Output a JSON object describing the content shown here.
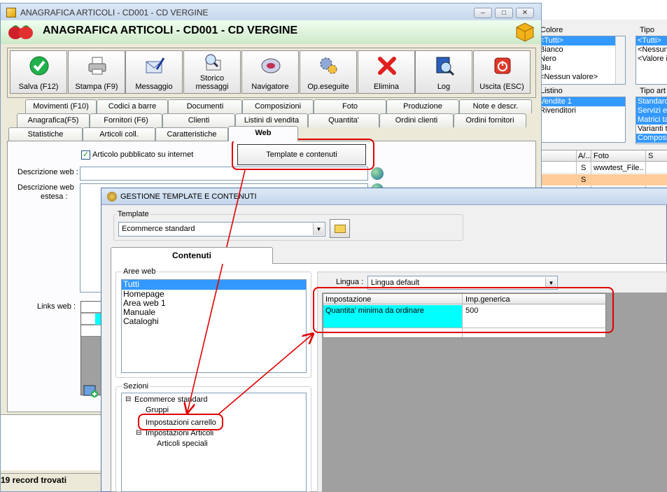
{
  "right_panel": {
    "colore_label": "Colore",
    "tipo_label": "Tipo",
    "colore_items": [
      "<Tutti>",
      "Bianco",
      "Nero",
      "Blu",
      "<Nessun valore>"
    ],
    "tipo_items": [
      "<Tutti>",
      "<Nessun",
      "<Valore i"
    ],
    "listino_label": "Listino",
    "tipo_articolo_label": "Tipo art",
    "listino_items": [
      "Vendite 1",
      "Rivenditori"
    ],
    "tipo_articolo_items": [
      "Standard",
      "Servizi e",
      "Matrici ta",
      "Varianti t",
      "Composi"
    ],
    "grid_headers": [
      "",
      "A/...",
      "Foto",
      "S"
    ],
    "grid_rows": [
      {
        "c1": "S",
        "c2": "wwwtest_File..."
      },
      {
        "c1": "S",
        "c2": ""
      }
    ]
  },
  "main_window": {
    "title": "ANAGRAFICA ARTICOLI - CD001 - CD VERGINE",
    "header": "ANAGRAFICA ARTICOLI - CD001 - CD VERGINE",
    "toolbar": [
      {
        "icon": "check-icon",
        "label": "Salva (F12)"
      },
      {
        "icon": "printer-icon",
        "label": "Stampa (F9)"
      },
      {
        "icon": "envelope-pen-icon",
        "label": "Messaggio"
      },
      {
        "icon": "magnifier-envelope-icon",
        "label": "Storico messaggi"
      },
      {
        "icon": "navigator-icon",
        "label": "Navigatore"
      },
      {
        "icon": "gears-icon",
        "label": "Op.eseguite"
      },
      {
        "icon": "red-x-icon",
        "label": "Elimina"
      },
      {
        "icon": "log-book-icon",
        "label": "Log"
      },
      {
        "icon": "power-icon",
        "label": "Uscita (ESC)"
      }
    ],
    "tabs_row1": [
      "Movimenti (F10)",
      "Codici a barre",
      "Documenti",
      "Composizioni",
      "Foto",
      "Produzione",
      "Note e descr."
    ],
    "tabs_row2": [
      "Anagrafica(F5)",
      "Fornitori (F6)",
      "Clienti",
      "Listini di vendita",
      "Quantita'",
      "Ordini clienti",
      "Ordini fornitori"
    ],
    "tabs_row3": [
      "Statistiche",
      "Articoli coll.",
      "Caratteristiche",
      "Web"
    ],
    "checkbox_label": "Articolo pubblicato su internet",
    "template_button": "Template e contenuti",
    "descrizione_web_label": "Descrizione web :",
    "descrizione_estesa_label1": "Descrizione web",
    "descrizione_estesa_label2": "estesa :",
    "links_label": "Links web :",
    "status": "19 record trovati"
  },
  "dialog": {
    "title": "GESTIONE TEMPLATE E CONTENUTI",
    "template_group": "Template",
    "template_value": "Ecommerce standard",
    "tab_label": "Contenuti",
    "aree_label": "Aree web",
    "aree_items": [
      "Tutti",
      "Homepage",
      "Area web 1",
      "Manuale",
      "Cataloghi"
    ],
    "sezioni_label": "Sezioni",
    "tree_root": "Ecommerce standard",
    "tree_children": [
      "Gruppi",
      "Impostazioni carrello",
      "Impostazioni Articoli"
    ],
    "tree_grandchild": "Articoli speciali",
    "lingua_label": "Lingua :",
    "lingua_value": "Lingua default",
    "grid_headers": [
      "Impostazione",
      "Imp.generica"
    ],
    "grid_row": {
      "impostazione": "Quantita' minima da ordinare",
      "valore": "500"
    }
  },
  "colors": {
    "annotation_red": "#e00000",
    "highlight_cyan": "#00ffff",
    "selection_blue": "#3399ff",
    "grid_orange": "#ffcc99"
  }
}
